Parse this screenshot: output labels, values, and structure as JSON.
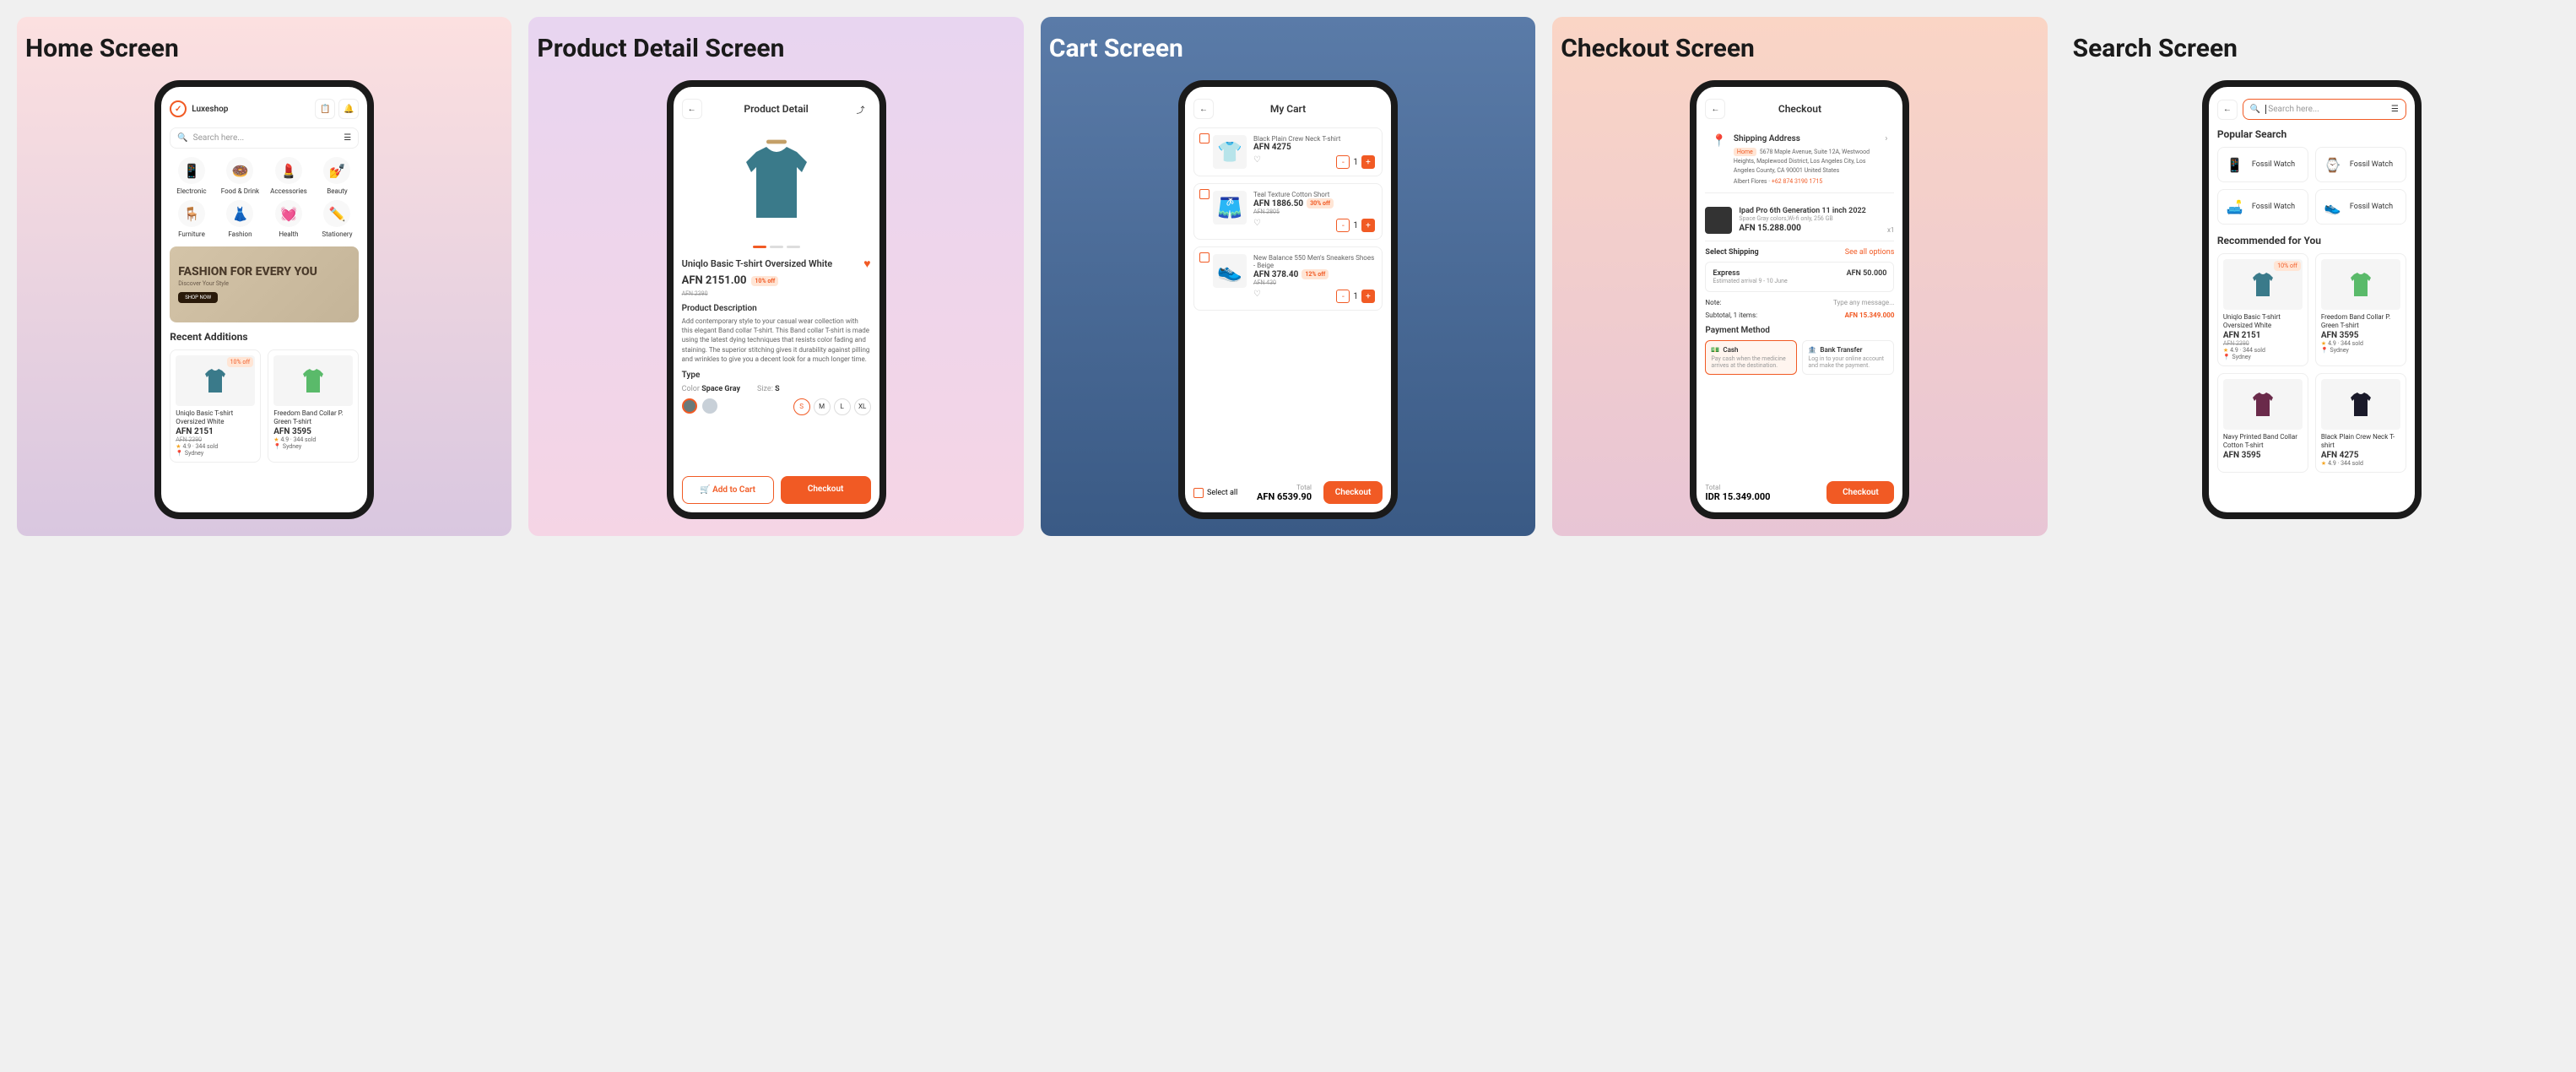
{
  "panels": [
    "Home Screen",
    "Product Detail Screen",
    "Cart Screen",
    "Checkout Screen",
    "Search Screen"
  ],
  "home": {
    "brand": "Luxeshop",
    "search_placeholder": "Search here...",
    "categories": [
      {
        "label": "Electronic",
        "emoji": "📱"
      },
      {
        "label": "Food & Drink",
        "emoji": "🍩"
      },
      {
        "label": "Accessories",
        "emoji": "💄"
      },
      {
        "label": "Beauty",
        "emoji": "💅"
      },
      {
        "label": "Furniture",
        "emoji": "🪑"
      },
      {
        "label": "Fashion",
        "emoji": "👗"
      },
      {
        "label": "Health",
        "emoji": "💓"
      },
      {
        "label": "Stationery",
        "emoji": "✏️"
      }
    ],
    "banner": {
      "title": "FASHION FOR EVERY YOU",
      "subtitle": "Discover Your Style",
      "cta": "SHOP NOW"
    },
    "recent_title": "Recent Additions",
    "products": [
      {
        "name": "Uniqlo Basic T-shirt Oversized White",
        "price": "AFN 2151",
        "old": "AFN 2390",
        "badge": "10% off",
        "rating": "4.9",
        "sold": "344 sold",
        "loc": "Sydney"
      },
      {
        "name": "Freedom Band Collar P. Green T-shirt",
        "price": "AFN 3595",
        "rating": "4.9",
        "sold": "344 sold",
        "loc": "Sydney"
      }
    ]
  },
  "detail": {
    "header": "Product Detail",
    "title": "Uniqlo Basic T-shirt Oversized White",
    "price": "AFN 2151.00",
    "badge": "10% off",
    "old": "AFN 2390",
    "desc_title": "Product Description",
    "desc": "Add contemporary style to your casual wear collection with this elegant Band collar T-shirt. This Band collar T-shirt is made using the latest dying techniques that resists color fading and staining. The superior stitching gives it durability against pilling and wrinkles to give you a decent look for a much longer time.",
    "type_label": "Type",
    "color_label": "Color",
    "color_value": "Space Gray",
    "size_label": "Size:",
    "size_value": "S",
    "sizes": [
      "S",
      "M",
      "L",
      "XL"
    ],
    "add_cart": "Add to Cart",
    "checkout": "Checkout"
  },
  "cart": {
    "header": "My Cart",
    "items": [
      {
        "name": "Black Plain Crew Neck T-shirt",
        "price": "AFN 4275",
        "qty": "1"
      },
      {
        "name": "Teal Texture Cotton Short",
        "price": "AFN 1886.50",
        "badge": "30% off",
        "old": "AFN 2805",
        "qty": "1"
      },
      {
        "name": "New Balance 550 Men's Sneakers Shoes - Beige",
        "price": "AFN 378.40",
        "badge": "12% off",
        "old": "AFN 430",
        "qty": "1"
      }
    ],
    "select_all": "Select all",
    "total_label": "Total",
    "total": "AFN 6539.90",
    "checkout": "Checkout"
  },
  "checkout": {
    "header": "Checkout",
    "addr_title": "Shipping Address",
    "addr_tag": "Home",
    "addr": "5678 Maple Avenue, Suite 12A, Westwood Heights, Maplewood District, Los Angeles City, Los Angeles County, CA 90001 United States",
    "addr_name": "Albert Flores",
    "addr_phone": "+62 874 3190 1715",
    "order_name": "Ipad Pro 6th Generation 11 inch 2022",
    "order_variant": "Space Gray colors,Wi-fi only, 256 GB",
    "order_price": "AFN 15.288.000",
    "order_qty": "x1",
    "ship_title": "Select Shipping",
    "ship_link": "See all options",
    "ship_name": "Express",
    "ship_est": "Estimated arrival 9 - 10 June",
    "ship_price": "AFN 50.000",
    "note_label": "Note:",
    "note_placeholder": "Type any message...",
    "sub_label": "Subtotal, 1 items:",
    "sub_value": "AFN 15.349.000",
    "pay_title": "Payment Method",
    "pay_cash": "Cash",
    "pay_cash_desc": "Pay cash when the medicine arrives at the destination.",
    "pay_bank": "Bank Transfer",
    "pay_bank_desc": "Log in to your online account and make the payment.",
    "total_label": "Total",
    "total": "IDR 15.349.000",
    "checkout": "Checkout"
  },
  "search": {
    "placeholder": "Search here...",
    "popular_title": "Popular Search",
    "popular": [
      {
        "label": "Fossil Watch",
        "emoji": "📱"
      },
      {
        "label": "Fossil Watch",
        "emoji": "⌚"
      },
      {
        "label": "Fossil Watch",
        "emoji": "🛋️"
      },
      {
        "label": "Fossil Watch",
        "emoji": "👟"
      }
    ],
    "rec_title": "Recommended for You",
    "products": [
      {
        "name": "Uniqlo Basic T-shirt Oversized White",
        "price": "AFN 2151",
        "old": "AFN 2390",
        "badge": "10% off",
        "rating": "4.9",
        "sold": "344 sold",
        "loc": "Sydney"
      },
      {
        "name": "Freedom Band Collar P. Green T-shirt",
        "price": "AFN 3595",
        "rating": "4.9",
        "sold": "344 sold",
        "loc": "Sydney"
      },
      {
        "name": "Navy Printed Band Collar Cotton T-shirt",
        "price": "AFN 3595"
      },
      {
        "name": "Black Plain Crew Neck T-shirt",
        "price": "AFN 4275",
        "rating": "4.9",
        "sold": "344 sold"
      }
    ]
  }
}
